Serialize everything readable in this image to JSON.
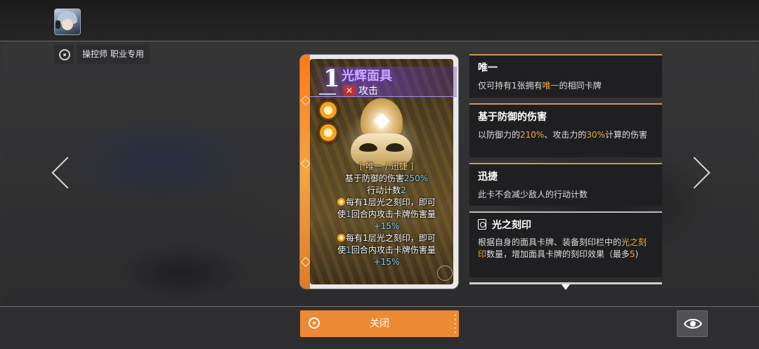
{
  "job_tag": {
    "label": "操控师 职业专用"
  },
  "card": {
    "cost": "1",
    "name": "光辉面具",
    "type_icon": "crossed-swords-icon",
    "type_label": "攻击",
    "description": {
      "tag_line": "[ 唯一 / 迅捷 ]",
      "line1_prefix": "基于防御的伤害",
      "line1_value": "250%",
      "line2_prefix": "行动计数",
      "line2_value": "2",
      "effect1_a": "每有1层光之刻印，即可",
      "effect1_b_prefix": "使",
      "effect1_b_value": "1",
      "effect1_b_suffix": "回合内攻击卡牌伤害量",
      "effect1_c": "+15%",
      "effect2_a": "每有1层光之刻印，即可",
      "effect2_b_prefix": "使",
      "effect2_b_value": "1",
      "effect2_b_suffix": "回合内攻击卡牌伤害量",
      "effect2_c": "+15%"
    }
  },
  "panels": [
    {
      "title": "唯一",
      "body_a": "仅可持有1张拥有",
      "body_kw": "唯一",
      "body_b": "的相同卡牌"
    },
    {
      "title": "基于防御的伤害",
      "body_a": "以防御力的",
      "body_v1": "210%",
      "body_b": "、攻击力的",
      "body_v2": "30%",
      "body_c": "计算的伤害"
    },
    {
      "title": "迅捷",
      "body_a": "此卡不会减少敌人的行动计数"
    },
    {
      "title": "光之刻印",
      "body_a": "根据自身的面具卡牌、装备刻印栏中的",
      "body_kw": "光之刻印",
      "body_b": "数量，增加面具卡牌的刻印效果（最多",
      "body_v": "5",
      "body_c": ")"
    }
  ],
  "bottom": {
    "close_label": "关闭"
  },
  "colors": {
    "accent": "#ee8a33",
    "highlight": "#f0a83a",
    "card_name": "#cda9ff"
  }
}
